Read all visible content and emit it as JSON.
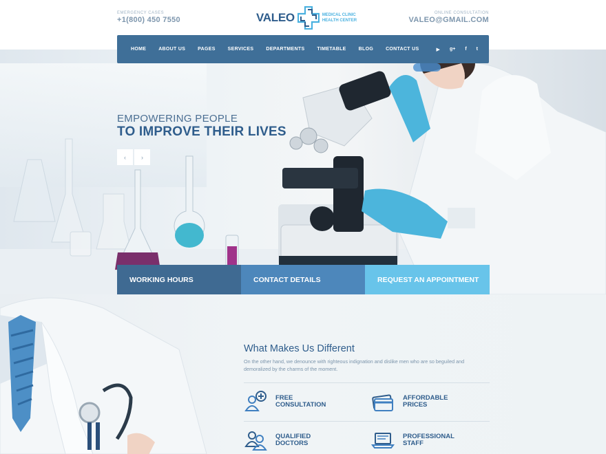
{
  "header": {
    "emergency_label": "EMERGENCY CASES",
    "phone": "+1(800) 450 7550",
    "online_label": "ONLINE CONSULTATION",
    "email": "VALEO@GMAIL.COM",
    "logo_word": "VALEO",
    "logo_sub_1": "MEDICAL CLINIC",
    "logo_sub_2": "HEALTH CENTER"
  },
  "nav": {
    "items": [
      "HOME",
      "ABOUT US",
      "PAGES",
      "SERVICES",
      "DEPARTMENTS",
      "TIMETABLE",
      "BLOG",
      "CONTACT US"
    ],
    "social": [
      "youtube-icon",
      "google-plus-icon",
      "facebook-icon",
      "twitter-icon"
    ],
    "social_glyphs": [
      "▶",
      "g+",
      "f",
      "t"
    ]
  },
  "hero": {
    "line1": "EMPOWERING PEOPLE",
    "line2": "TO IMPROVE THEIR LIVES",
    "prev": "‹",
    "next": "›"
  },
  "boxes": [
    "WORKING HOURS",
    "CONTACT DETAILS",
    "REQUEST AN APPOINTMENT"
  ],
  "section": {
    "title": "What Makes Us Different",
    "desc": "On the other hand, we denounce with righteous indignation and dislike men who are so beguiled and demoralized by the charms of the moment.",
    "features": [
      {
        "line1": "FREE",
        "line2": "CONSULTATION",
        "icon": "user-plus-icon"
      },
      {
        "line1": "AFFORDABLE",
        "line2": "PRICES",
        "icon": "credit-card-icon"
      },
      {
        "line1": "QUALIFIED",
        "line2": "DOCTORS",
        "icon": "users-icon"
      },
      {
        "line1": "PROFESSIONAL",
        "line2": "STAFF",
        "icon": "laptop-icon"
      }
    ]
  },
  "colors": {
    "brand_dark": "#2f5d8c",
    "nav_bg": "#3f6f98",
    "box1": "#3f6a92",
    "box2": "#4d87bb",
    "box3": "#68c4ea",
    "accent_light": "#4ab1e0"
  }
}
